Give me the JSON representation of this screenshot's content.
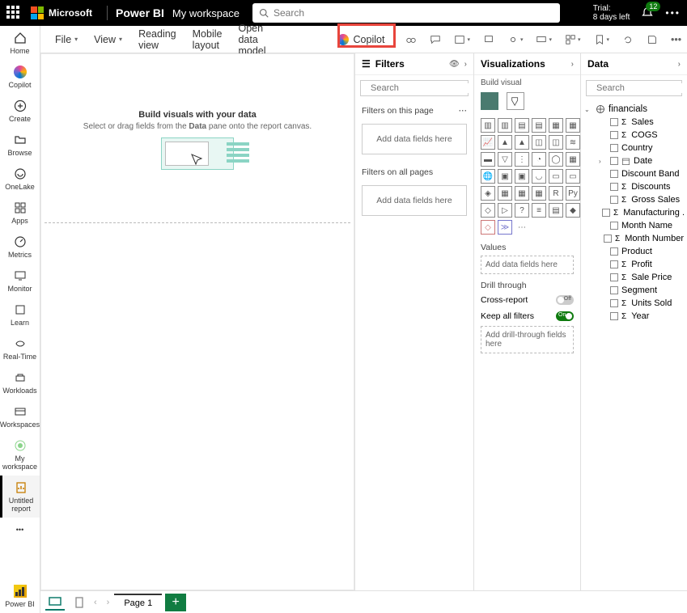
{
  "header": {
    "brand": "Microsoft",
    "product": "Power BI",
    "workspace": "My workspace",
    "search_placeholder": "Search",
    "trial_line1": "Trial:",
    "trial_line2": "8 days left",
    "notif_count": "12"
  },
  "leftrail": {
    "items": [
      {
        "label": "Home",
        "icon": "home-icon"
      },
      {
        "label": "Copilot",
        "icon": "copilot-icon"
      },
      {
        "label": "Create",
        "icon": "plus-icon"
      },
      {
        "label": "Browse",
        "icon": "folder-icon"
      },
      {
        "label": "OneLake",
        "icon": "onelake-icon"
      },
      {
        "label": "Apps",
        "icon": "apps-icon"
      },
      {
        "label": "Metrics",
        "icon": "metrics-icon"
      },
      {
        "label": "Monitor",
        "icon": "monitor-icon"
      },
      {
        "label": "Learn",
        "icon": "learn-icon"
      },
      {
        "label": "Real-Time",
        "icon": "realtime-icon"
      },
      {
        "label": "Workloads",
        "icon": "workloads-icon"
      },
      {
        "label": "Workspaces",
        "icon": "workspaces-icon"
      },
      {
        "label": "My workspace",
        "icon": "myworkspace-icon"
      }
    ],
    "selected": {
      "label": "Untitled report",
      "icon": "report-icon"
    },
    "bottom": {
      "label": "Power BI"
    }
  },
  "ribbon": {
    "menus": [
      "File",
      "View",
      "Reading view",
      "Mobile layout",
      "Open data model"
    ],
    "copilot": "Copilot"
  },
  "canvas": {
    "heading": "Build visuals with your data",
    "sub1": "Select or drag fields from the ",
    "sub_bold": "Data",
    "sub2": " pane onto the report canvas."
  },
  "filters": {
    "title": "Filters",
    "search_placeholder": "Search",
    "section_page": "Filters on this page",
    "section_all": "Filters on all pages",
    "dropzone": "Add data fields here"
  },
  "viz": {
    "title": "Visualizations",
    "build": "Build visual",
    "values": "Values",
    "values_dz": "Add data fields here",
    "drill": "Drill through",
    "cross": "Cross-report",
    "cross_state": "Off",
    "keep": "Keep all filters",
    "keep_state": "On",
    "drill_dz": "Add drill-through fields here"
  },
  "data": {
    "title": "Data",
    "search_placeholder": "Search",
    "table": "financials",
    "fields": [
      {
        "name": "Sales",
        "sigma": true,
        "expandable": false
      },
      {
        "name": "COGS",
        "sigma": true,
        "expandable": false
      },
      {
        "name": "Country",
        "sigma": false,
        "expandable": false
      },
      {
        "name": "Date",
        "sigma": false,
        "expandable": true,
        "date": true
      },
      {
        "name": "Discount Band",
        "sigma": false,
        "expandable": false
      },
      {
        "name": "Discounts",
        "sigma": true,
        "expandable": false
      },
      {
        "name": "Gross Sales",
        "sigma": true,
        "expandable": false
      },
      {
        "name": "Manufacturing ...",
        "sigma": true,
        "expandable": false
      },
      {
        "name": "Month Name",
        "sigma": false,
        "expandable": false
      },
      {
        "name": "Month Number",
        "sigma": true,
        "expandable": false
      },
      {
        "name": "Product",
        "sigma": false,
        "expandable": false
      },
      {
        "name": "Profit",
        "sigma": true,
        "expandable": false
      },
      {
        "name": "Sale Price",
        "sigma": true,
        "expandable": false
      },
      {
        "name": "Segment",
        "sigma": false,
        "expandable": false
      },
      {
        "name": "Units Sold",
        "sigma": true,
        "expandable": false
      },
      {
        "name": "Year",
        "sigma": true,
        "expandable": false
      }
    ]
  },
  "tabs": {
    "page": "Page 1"
  }
}
